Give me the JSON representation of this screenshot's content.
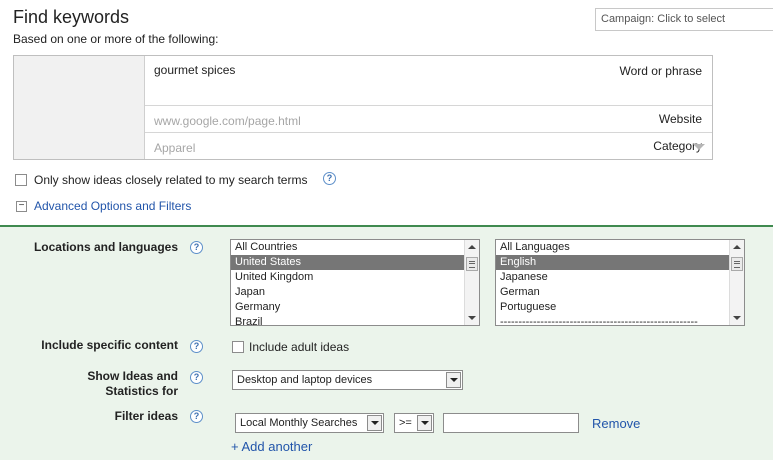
{
  "header": {
    "title": "Find keywords",
    "subtitle": "Based on one or more of the following:",
    "campaign_placeholder": "Campaign: Click to select"
  },
  "form": {
    "word_label": "Word or phrase",
    "word_value": "gourmet spices",
    "website_label": "Website",
    "website_placeholder": "www.google.com/page.html",
    "category_label": "Category",
    "category_placeholder": "Apparel"
  },
  "options": {
    "closely_related_label": "Only show ideas closely related to my search terms",
    "closely_related_checked": false,
    "advanced_toggle": "Advanced Options and Filters"
  },
  "advanced": {
    "locations_label": "Locations and languages",
    "locations": [
      "All Countries",
      "United States",
      "United Kingdom",
      "Japan",
      "Germany",
      "Brazil"
    ],
    "locations_selected": "United States",
    "languages": [
      "All Languages",
      "English",
      "Japanese",
      "German",
      "Portuguese",
      "------------------------------------------------------"
    ],
    "languages_selected": "English",
    "specific_content_label": "Include specific content",
    "adult_ideas_label": "Include adult ideas",
    "adult_ideas_checked": false,
    "show_ideas_label_line1": "Show Ideas and",
    "show_ideas_label_line2": "Statistics for",
    "device_value": "Desktop and laptop devices",
    "filter_label": "Filter ideas",
    "filter_metric": "Local Monthly Searches",
    "filter_operator": ">=",
    "filter_value": "",
    "remove_link": "Remove",
    "add_another_link": "+ Add another"
  },
  "icons": {
    "help": "help-icon",
    "dropdown": "chevron-down-icon",
    "collapse": "minus-icon"
  },
  "colors": {
    "panel_bg": "#ebf4eb",
    "panel_border": "#3f8a4f",
    "link": "#2255aa",
    "selected_item": "#767676"
  }
}
